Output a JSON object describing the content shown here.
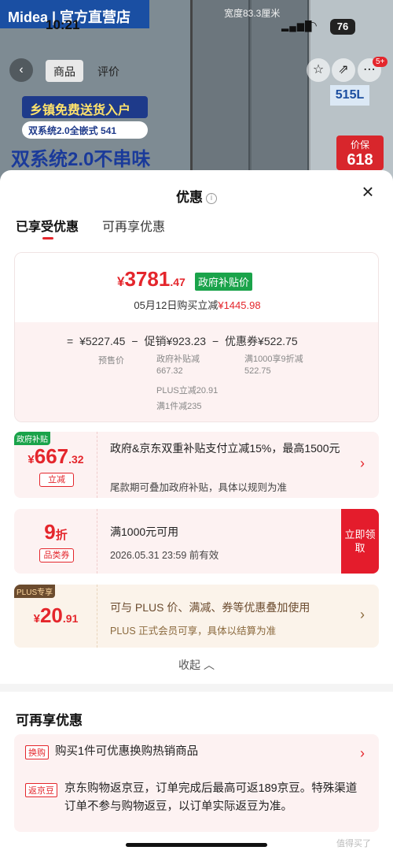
{
  "status_bar": {
    "time": "10:21",
    "battery": "76"
  },
  "background": {
    "brand": "Midea | 官方直营店",
    "width_label": "宽度83.3厘米",
    "nav_tabs": [
      "商品",
      "评价"
    ],
    "cart_badge": "5+",
    "promo_lines": [
      "乡镇免费送货入户",
      "双系统2.0全嵌式 541",
      "双系统2.0不串味"
    ],
    "promo_right": "515L",
    "price_tag_label": "价保",
    "price_tag_value": "618"
  },
  "sheet": {
    "title": "优惠",
    "tabs": [
      "已享受优惠",
      "可再享优惠"
    ],
    "summary": {
      "currency": "¥",
      "price_int": "3781",
      "price_dec": ".47",
      "gov_tag": "政府补贴价",
      "date_line": "05月12日购买立减",
      "date_amount": "¥1445.98",
      "formula": [
        "=",
        "¥5227.45",
        "−",
        "促销¥923.23",
        "−",
        "优惠券¥522.75"
      ],
      "presale_label": "预售价",
      "promo_detail_1": "政府补贴减 667.32",
      "promo_detail_2": "PLUS立减20.91",
      "promo_detail_3": "满1件减235",
      "coupon_detail": "满1000享9折减 522.75"
    },
    "coupon1": {
      "corner": "政府补贴",
      "currency": "¥",
      "int": "667",
      "dec": ".32",
      "pill": "立减",
      "desc": "政府&京东双重补贴支付立减15%，最高1500元",
      "sub": "尾款期可叠加政府补贴，具体以规则为准"
    },
    "coupon2": {
      "value": "9",
      "unit": "折",
      "pill": "品类券",
      "desc": "满1000元可用",
      "sub": "2026.05.31 23:59 前有效",
      "button": "立即领取"
    },
    "coupon3": {
      "corner": "PLUS专享",
      "currency": "¥",
      "int": "20",
      "dec": ".91",
      "desc": "可与 PLUS 价、满减、券等优惠叠加使用",
      "sub": "PLUS 正式会员可享，具体以结算为准"
    },
    "collapse_label": "收起",
    "more_title": "可再享优惠",
    "more_rows": [
      {
        "tag": "换购",
        "text": "购买1件可优惠换购热销商品"
      },
      {
        "tag": "返京豆",
        "text": "京东购物返京豆，订单完成后最高可返189京豆。特殊渠道订单不参与购物返豆，以订单实际返豆为准。"
      }
    ],
    "watermark": "值得买了"
  },
  "colors": {
    "accent": "#e4262c",
    "green_tag": "#1aa34a",
    "plus_brown": "#6b4b2e"
  }
}
